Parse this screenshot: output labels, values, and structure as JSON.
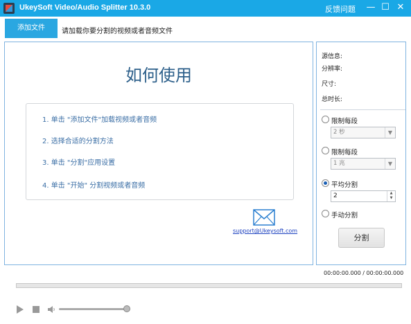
{
  "window": {
    "title": "UkeySoft Video/Audio Splitter 10.3.0",
    "feedback_label": "反馈问题",
    "minimize_symbol": "—",
    "maximize_symbol": "☐",
    "close_symbol": "✕",
    "accent_color": "#1aa8e6"
  },
  "toolbar": {
    "add_file_label": "添加文件",
    "add_file_hint": "请加载你要分割的视频或者音频文件"
  },
  "guide": {
    "title": "如何使用",
    "steps": [
      "1. 单击 \"添加文件\"加载视频或者音频",
      "2. 选择合适的分割方法",
      "3. 单击 \"分割\"应用设置",
      "4. 单击 \"开始\" 分割视频或者音频"
    ],
    "mail_icon": "envelope-icon",
    "support_email": "support@Ukeysoft.com"
  },
  "info": {
    "source_label": "源信息:",
    "resolution_label": "分辨率:",
    "size_label": "尺寸:",
    "duration_label": "总时长:"
  },
  "split_options": {
    "by_time_label": "限制每段",
    "by_time_value": "2 秒",
    "by_size_label": "限制每段",
    "by_size_value": "1 兆",
    "average_label": "平均分割",
    "average_value": "2",
    "manual_label": "手动分割",
    "selected": "average",
    "split_button_label": "分割"
  },
  "player": {
    "time_readout": "00:00:00.000 / 00:00:00.000",
    "volume_fraction": 0.93
  }
}
